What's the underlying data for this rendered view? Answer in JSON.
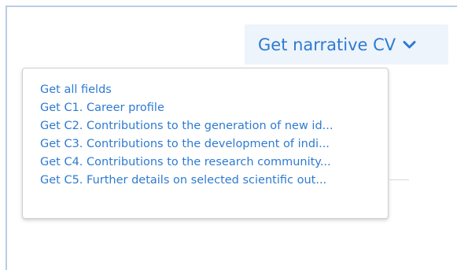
{
  "cv_button": {
    "label": "Get narrative CV",
    "icon": "chevron-down-icon"
  },
  "background_fragment": "’",
  "menu": {
    "items": [
      "Get all fields",
      "Get C1. Career profile",
      "Get C2. Contributions to the generation of new id...",
      "Get C3. Contributions to the development of indi...",
      "Get C4. Contributions to the research community...",
      "Get C5. Further details on selected scientific out..."
    ]
  },
  "colors": {
    "accent": "#2d7bd1",
    "button_bg": "#eef4fb",
    "frame_border": "#b9cde3"
  }
}
